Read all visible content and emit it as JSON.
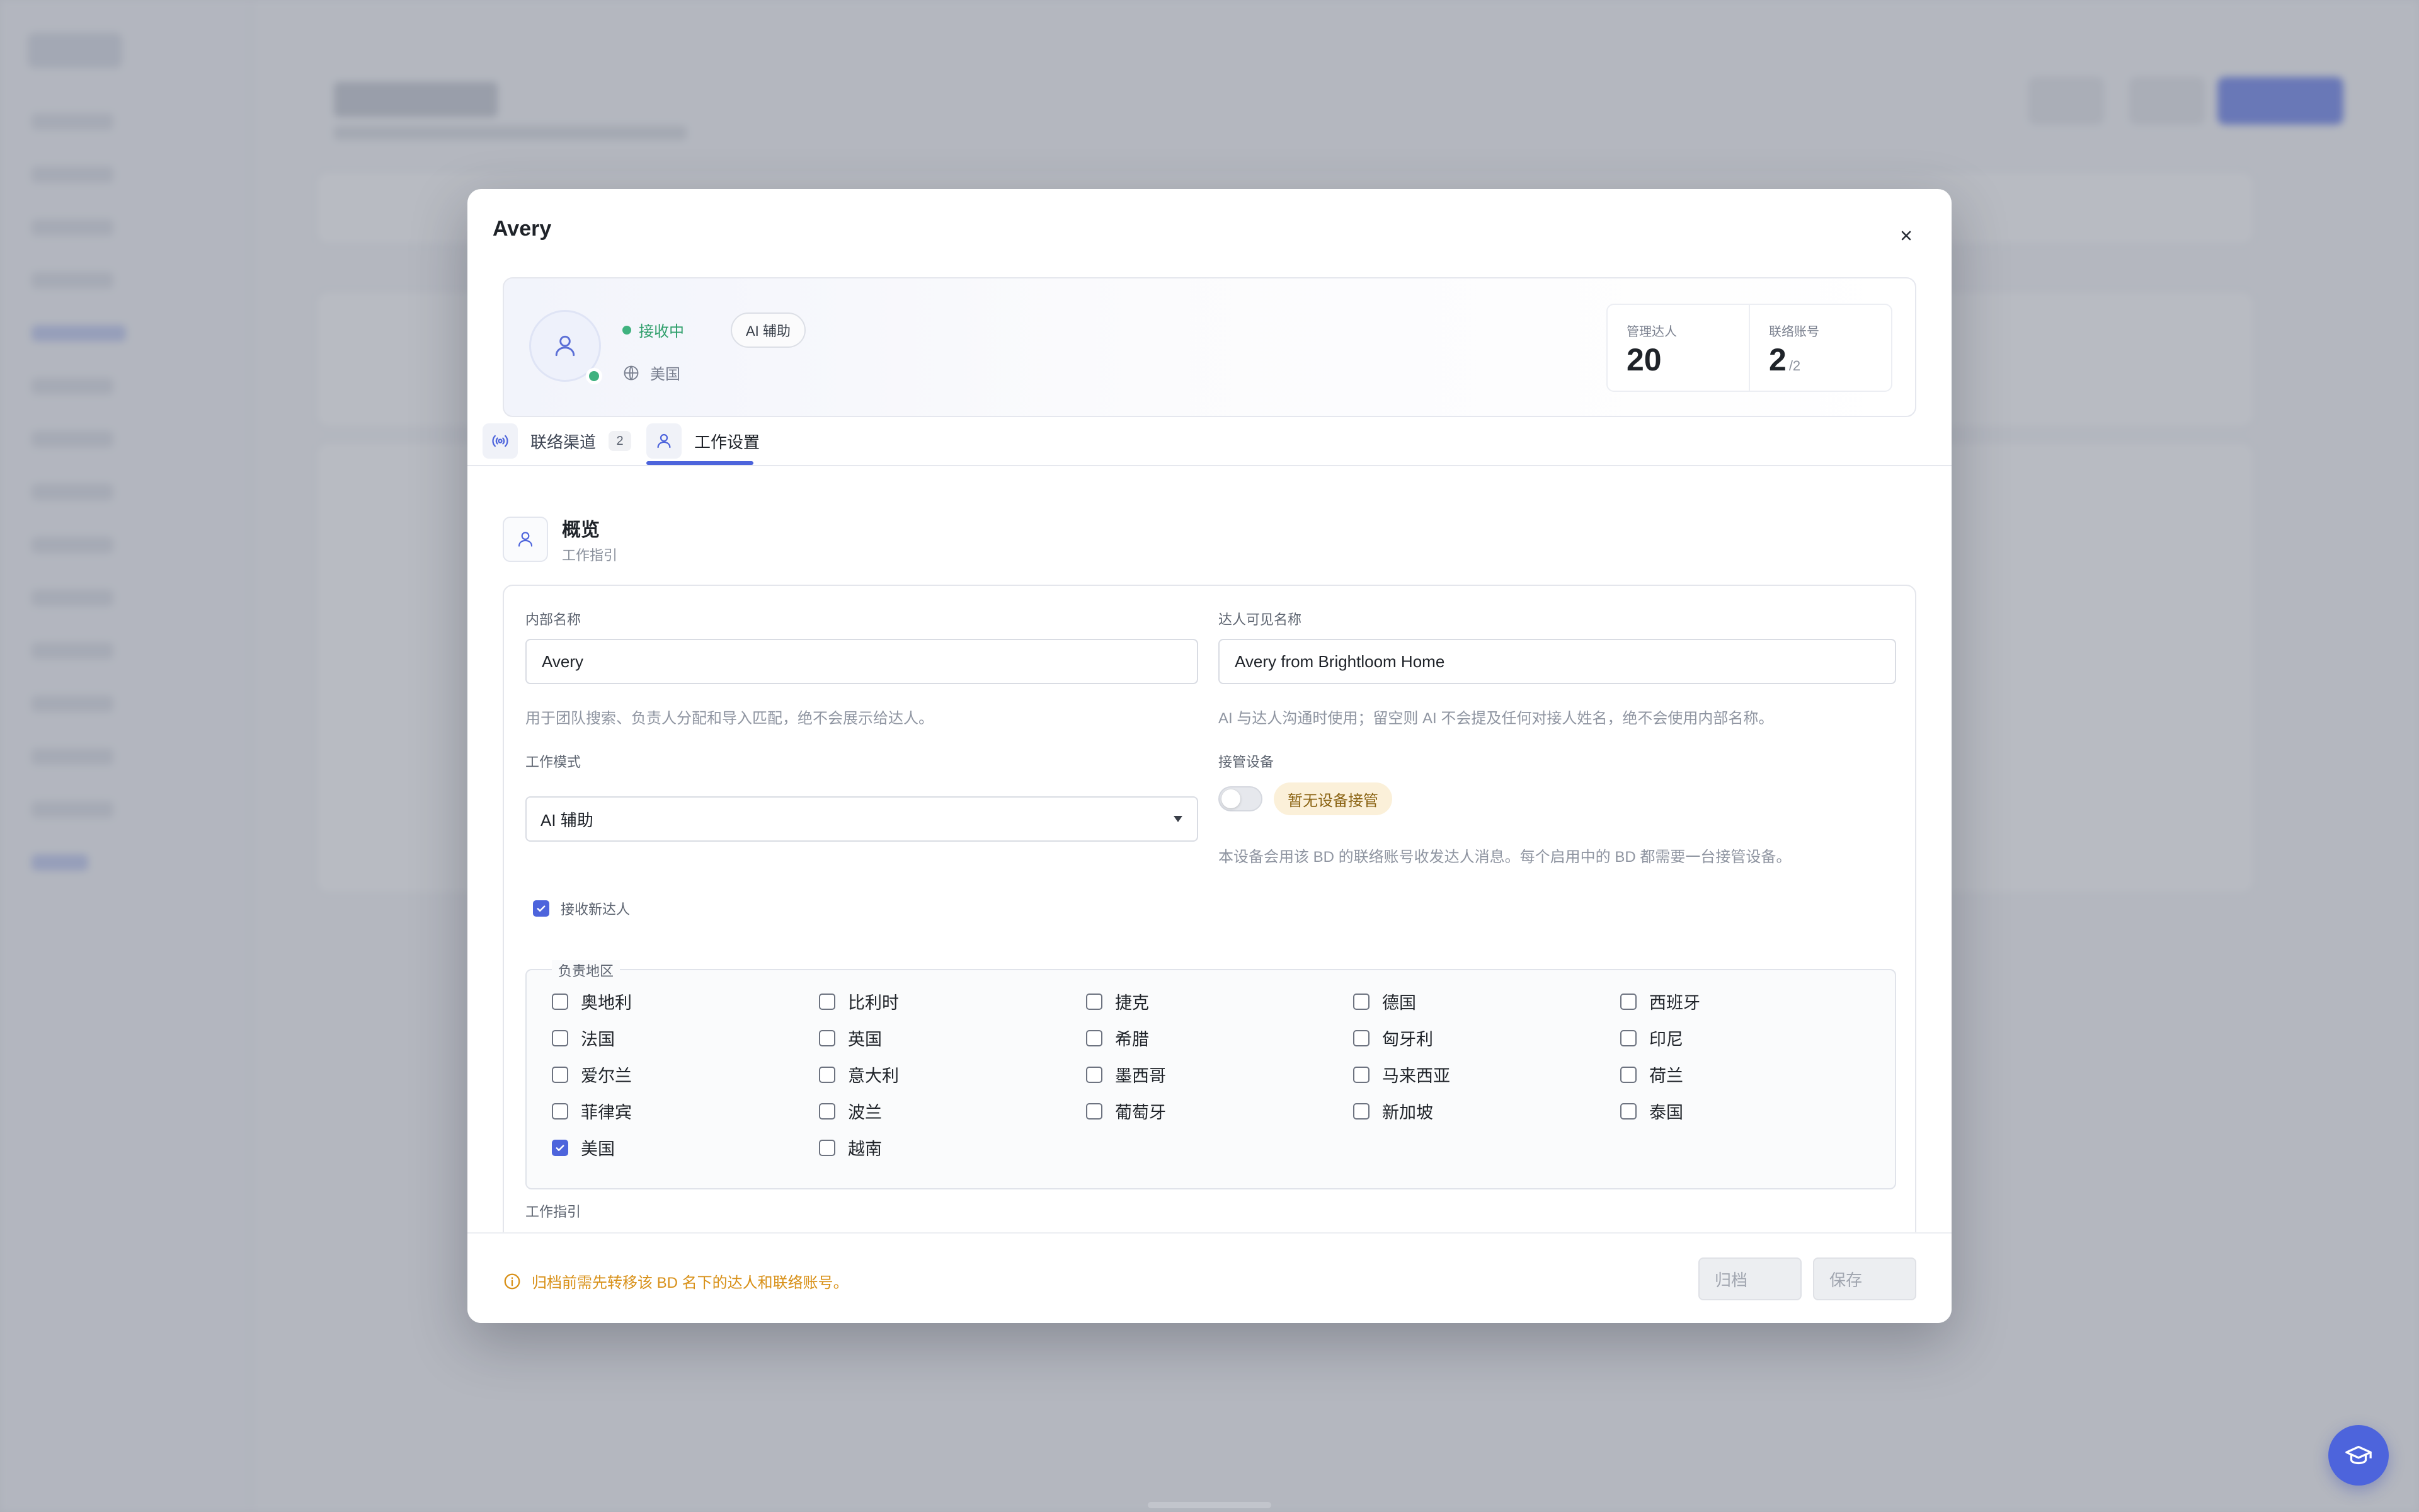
{
  "modal": {
    "title": "Avery",
    "close_icon": "close-icon",
    "profile": {
      "status": "接收中",
      "mode_badge": "AI 辅助",
      "region": "美国",
      "stats": {
        "managed_label": "管理达人",
        "managed_value": "20",
        "accounts_label": "联络账号",
        "accounts_value": "2",
        "accounts_total": "/2"
      }
    },
    "tabs": [
      {
        "label": "联络渠道",
        "count": "2",
        "icon": "broadcast-icon"
      },
      {
        "label": "工作设置",
        "icon": "user-icon",
        "active": true
      }
    ],
    "section": {
      "title": "概览",
      "subtitle": "工作指引",
      "icon": "user-icon"
    },
    "form": {
      "internal_name": {
        "label": "内部名称",
        "value": "Avery",
        "hint": "用于团队搜索、负责人分配和导入匹配，绝不会展示给达人。"
      },
      "visible_name": {
        "label": "达人可见名称",
        "value": "Avery from Brightloom Home",
        "hint": "AI 与达人沟通时使用；留空则 AI 不会提及任何对接人姓名，绝不会使用内部名称。"
      },
      "work_mode": {
        "label": "工作模式",
        "value": "AI 辅助"
      },
      "device": {
        "label": "接管设备",
        "badge": "暂无设备接管",
        "hint": "本设备会用该 BD 的联络账号收发达人消息。每个启用中的 BD 都需要一台接管设备。",
        "enabled": false
      },
      "accept_new": {
        "label": "接收新达人",
        "checked": true
      },
      "regions": {
        "legend": "负责地区",
        "items": [
          {
            "label": "奥地利",
            "checked": false
          },
          {
            "label": "比利时",
            "checked": false
          },
          {
            "label": "捷克",
            "checked": false
          },
          {
            "label": "德国",
            "checked": false
          },
          {
            "label": "西班牙",
            "checked": false
          },
          {
            "label": "法国",
            "checked": false
          },
          {
            "label": "英国",
            "checked": false
          },
          {
            "label": "希腊",
            "checked": false
          },
          {
            "label": "匈牙利",
            "checked": false
          },
          {
            "label": "印尼",
            "checked": false
          },
          {
            "label": "爱尔兰",
            "checked": false
          },
          {
            "label": "意大利",
            "checked": false
          },
          {
            "label": "墨西哥",
            "checked": false
          },
          {
            "label": "马来西亚",
            "checked": false
          },
          {
            "label": "荷兰",
            "checked": false
          },
          {
            "label": "菲律宾",
            "checked": false
          },
          {
            "label": "波兰",
            "checked": false
          },
          {
            "label": "葡萄牙",
            "checked": false
          },
          {
            "label": "新加坡",
            "checked": false
          },
          {
            "label": "泰国",
            "checked": false
          },
          {
            "label": "美国",
            "checked": true
          },
          {
            "label": "越南",
            "checked": false
          }
        ]
      },
      "guide_label": "工作指引"
    },
    "footer": {
      "warning": "归档前需先转移该 BD 名下的达人和联络账号。",
      "archive_label": "归档",
      "save_label": "保存"
    }
  },
  "colors": {
    "accent": "#4d64dc",
    "success": "#3fb27f",
    "warning": "#d89017"
  }
}
